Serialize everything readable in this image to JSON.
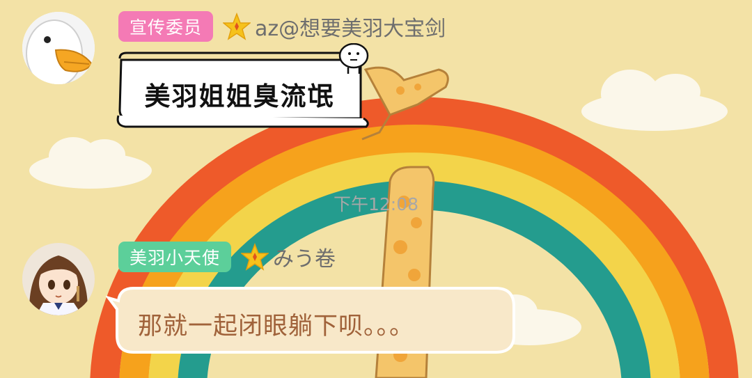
{
  "theme": {
    "background": "#f3e2a6",
    "badge_pink": "#f47ab5",
    "badge_green": "#5ccf9a",
    "star_yellow": "#f6c21b",
    "bubble_fill": "#f8e8c9",
    "bubble_text": "#a0623a"
  },
  "messages": [
    {
      "avatar_icon": "white-goose-avatar-icon",
      "title_badge": "宣传委员",
      "rank_icon": "star-icon",
      "username": "az@想要美羽大宝剑",
      "sticker_text": "美羽姐姐臭流氓"
    },
    {
      "avatar_icon": "anime-girl-avatar-icon",
      "title_badge": "美羽小天使",
      "rank_icon": "star-icon",
      "username": "みう卷",
      "text": "那就一起闭眼躺下呗。。。"
    }
  ],
  "timestamp": "下午12:08"
}
